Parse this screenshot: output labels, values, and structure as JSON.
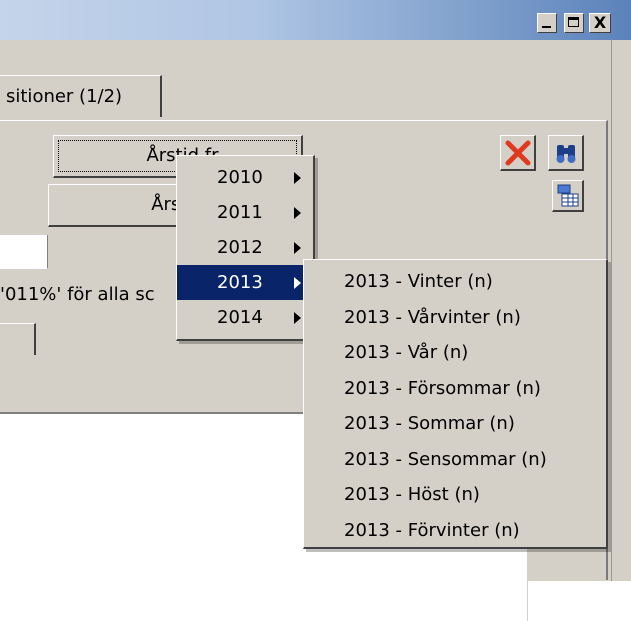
{
  "window": {
    "controls": {
      "minimize": "_",
      "maximize": "□",
      "close": "X"
    }
  },
  "tab": {
    "label": "sitioner (1/2)"
  },
  "buttons": {
    "season_from": "Årstid fr",
    "season_to": "Årstid"
  },
  "info": {
    "text": "'011%' för alla sc",
    "suffix": "11"
  },
  "icons": {
    "delete": "red-x-icon",
    "find": "binoculars-icon",
    "table": "table-icon",
    "delete_color": "#e03a1e"
  },
  "year_menu": {
    "items": [
      {
        "label": "2010",
        "selected": false
      },
      {
        "label": "2011",
        "selected": false
      },
      {
        "label": "2012",
        "selected": false
      },
      {
        "label": "2013",
        "selected": true
      },
      {
        "label": "2014",
        "selected": false
      }
    ]
  },
  "season_menu": {
    "items": [
      "2013 - Vinter (n)",
      "2013 - Vårvinter (n)",
      "2013 - Vår (n)",
      "2013 - Försommar (n)",
      "2013 - Sommar (n)",
      "2013 - Sensommar (n)",
      "2013 - Höst (n)",
      "2013 - Förvinter (n)"
    ]
  },
  "colors": {
    "selection": "#0a246a",
    "face": "#d4d0c8"
  }
}
